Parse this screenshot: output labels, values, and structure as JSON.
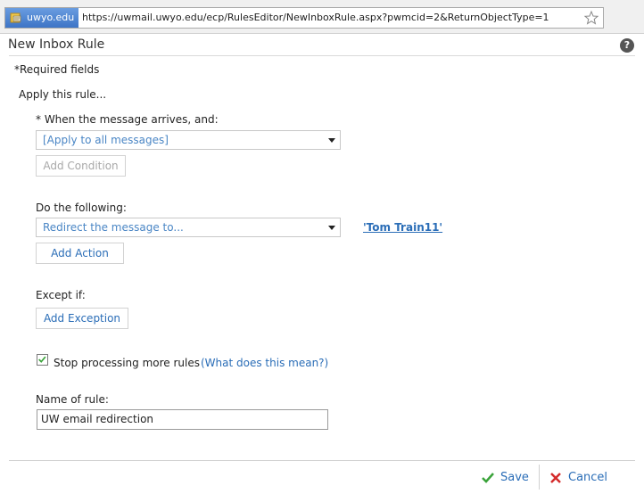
{
  "browser": {
    "site_chip": "uwyo.edu",
    "url": "https://uwmail.uwyo.edu/ecp/RulesEditor/NewInboxRule.aspx?pwmcid=2&ReturnObjectType=1"
  },
  "dialog": {
    "title": "New Inbox Rule",
    "help_glyph": "?"
  },
  "form": {
    "required_note": "*Required fields",
    "apply_heading": "Apply this rule...",
    "condition": {
      "label": "* When the message arrives, and:",
      "selected": "[Apply to all messages]",
      "add_button": "Add Condition"
    },
    "action": {
      "label": "Do the following:",
      "selected": "Redirect the message to...",
      "recipient_link": "'Tom Train11'",
      "add_button": "Add Action"
    },
    "exception": {
      "label": "Except if:",
      "add_button": "Add Exception"
    },
    "stop_processing": {
      "label": "Stop processing more rules",
      "help_link": "(What does this mean?)",
      "checked": true
    },
    "rule_name": {
      "label": "Name of rule:",
      "value": "UW email redirection"
    }
  },
  "footer": {
    "save_label": "Save",
    "cancel_label": "Cancel"
  },
  "colors": {
    "link": "#2a6db7",
    "save_check": "#3aa33a",
    "cancel_x": "#d42b2b"
  }
}
